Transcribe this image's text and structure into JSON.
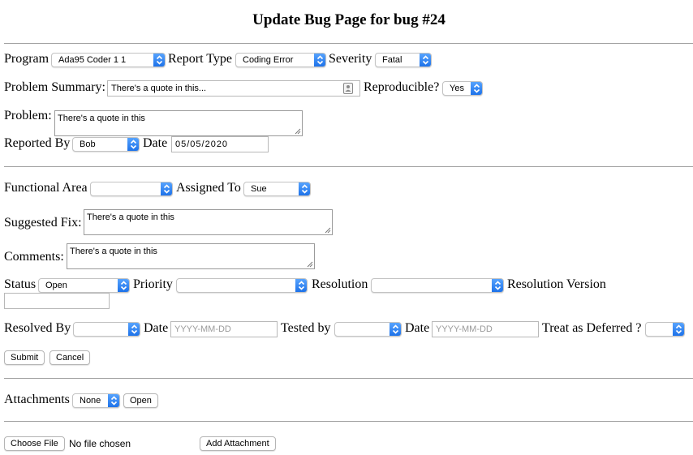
{
  "page": {
    "title": "Update Bug Page for bug #24"
  },
  "program": {
    "label": "Program",
    "value": "Ada95 Coder 1 1"
  },
  "report_type": {
    "label": "Report Type",
    "value": "Coding Error"
  },
  "severity": {
    "label": "Severity",
    "value": "Fatal"
  },
  "problem_summary": {
    "label": "Problem Summary:",
    "value": "There's a quote in this..."
  },
  "reproducible": {
    "label": "Reproducible?",
    "value": "Yes"
  },
  "problem": {
    "label": "Problem:",
    "value": "There's a quote in this"
  },
  "reported_by": {
    "label": "Reported By",
    "value": "Bob"
  },
  "report_date": {
    "label": "Date",
    "value": "05/05/2020"
  },
  "functional_area": {
    "label": "Functional Area",
    "value": ""
  },
  "assigned_to": {
    "label": "Assigned To",
    "value": "Sue"
  },
  "suggested_fix": {
    "label": "Suggested Fix:",
    "value": "There's a quote in this"
  },
  "comments": {
    "label": "Comments:",
    "value": "There's a quote in this"
  },
  "status": {
    "label": "Status",
    "value": "Open"
  },
  "priority": {
    "label": "Priority",
    "value": ""
  },
  "resolution": {
    "label": "Resolution",
    "value": ""
  },
  "resolution_version": {
    "label": "Resolution Version",
    "value": ""
  },
  "resolved_by": {
    "label": "Resolved By",
    "value": ""
  },
  "resolved_date": {
    "label": "Date",
    "placeholder": "YYYY-MM-DD"
  },
  "tested_by": {
    "label": "Tested by",
    "value": ""
  },
  "tested_date": {
    "label": "Date",
    "placeholder": "YYYY-MM-DD"
  },
  "deferred": {
    "label": "Treat as Deferred ?",
    "value": ""
  },
  "actions": {
    "submit": "Submit",
    "cancel": "Cancel"
  },
  "attachments": {
    "label": "Attachments",
    "value": "None",
    "open": "Open"
  },
  "upload": {
    "choose": "Choose File",
    "status": "No file chosen",
    "add": "Add Attachment"
  },
  "colors": {
    "select_caret": "#2f80f0",
    "rule": "#a0a0a0"
  }
}
